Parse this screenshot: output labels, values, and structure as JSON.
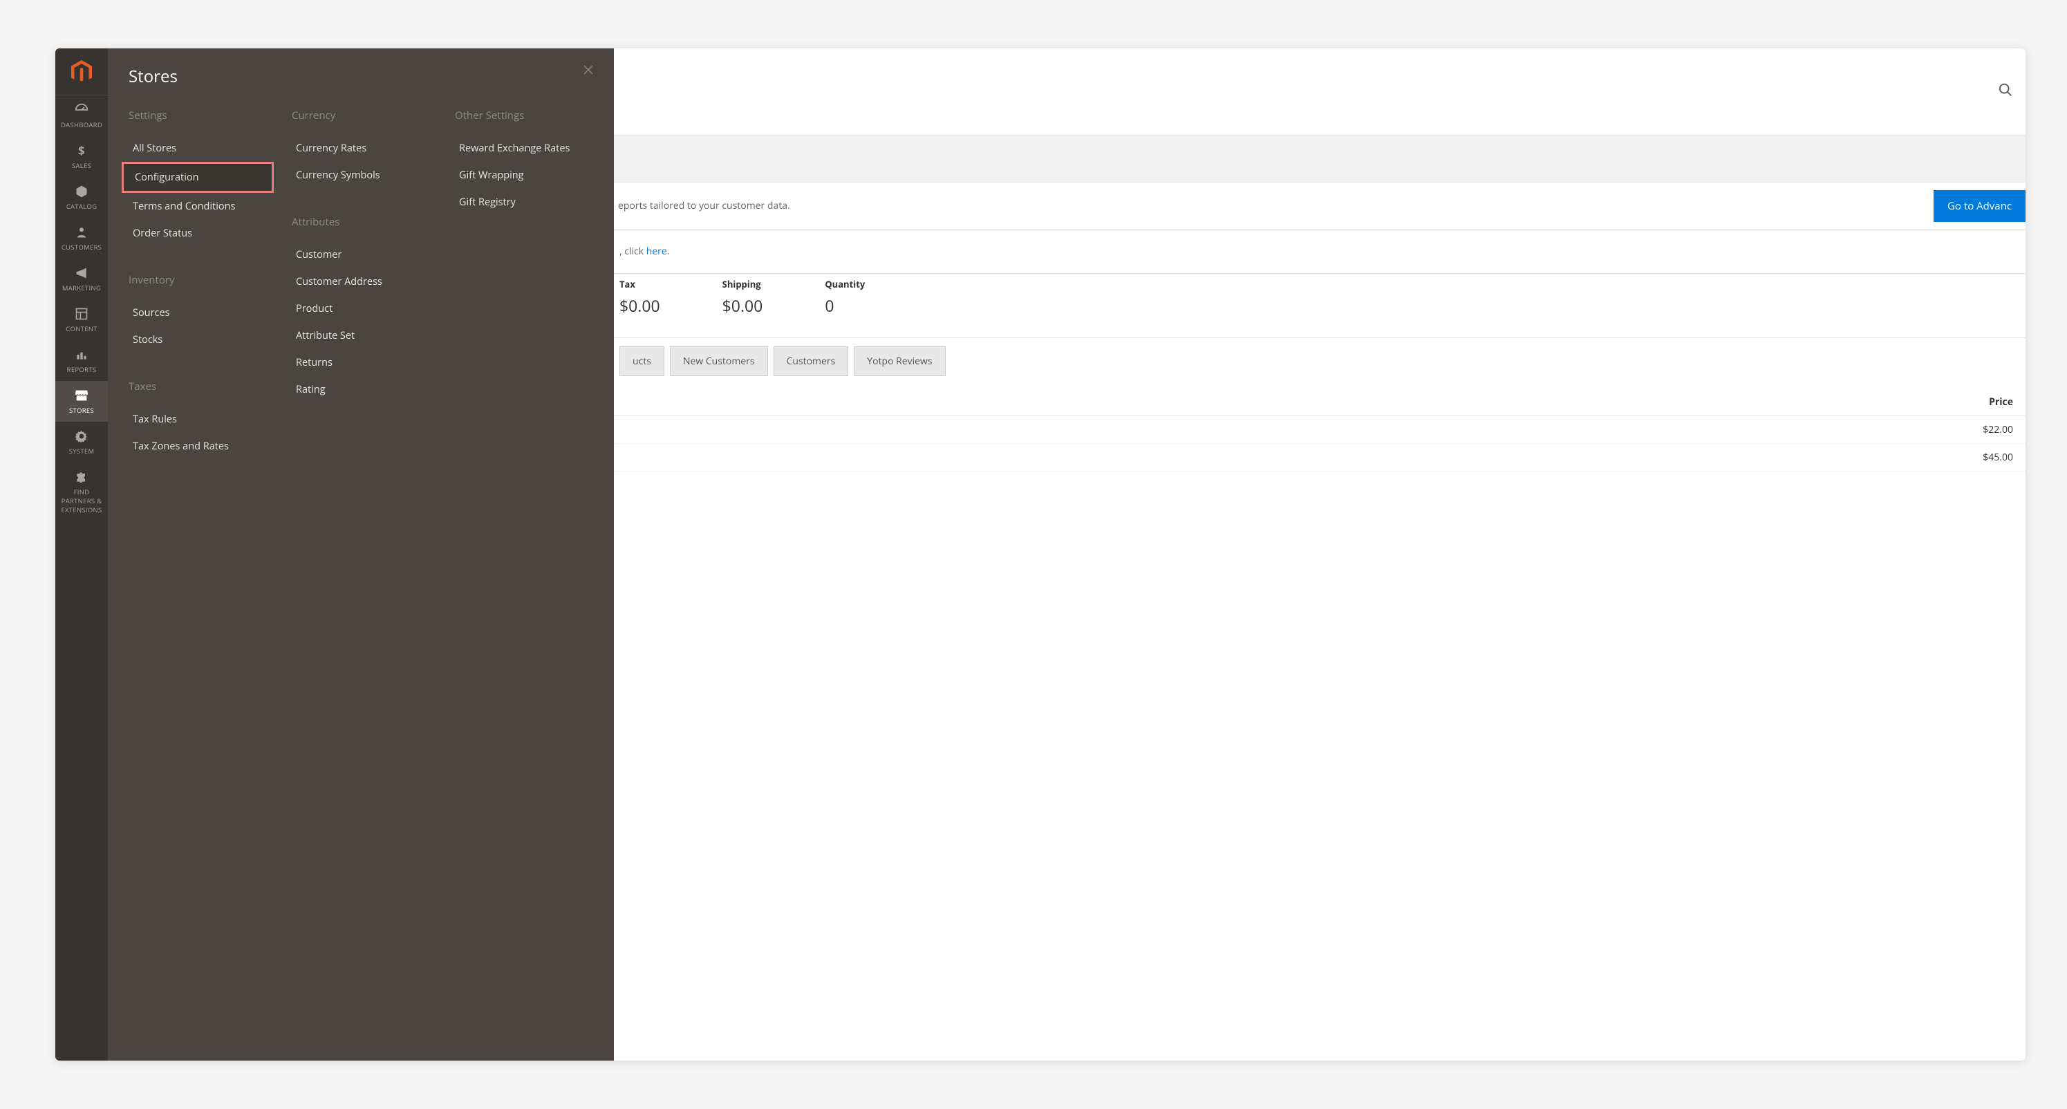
{
  "sidebar": {
    "items": [
      {
        "key": "dashboard",
        "label": "DASHBOARD"
      },
      {
        "key": "sales",
        "label": "SALES"
      },
      {
        "key": "catalog",
        "label": "CATALOG"
      },
      {
        "key": "customers",
        "label": "CUSTOMERS"
      },
      {
        "key": "marketing",
        "label": "MARKETING"
      },
      {
        "key": "content",
        "label": "CONTENT"
      },
      {
        "key": "reports",
        "label": "REPORTS"
      },
      {
        "key": "stores",
        "label": "STORES",
        "active": true
      },
      {
        "key": "system",
        "label": "SYSTEM"
      },
      {
        "key": "partners",
        "label": "FIND PARTNERS & EXTENSIONS"
      }
    ]
  },
  "flyout": {
    "title": "Stores",
    "columns": [
      {
        "groups": [
          {
            "heading": "Settings",
            "items": [
              "All Stores",
              "Configuration",
              "Terms and Conditions",
              "Order Status"
            ],
            "highlight_index": 1
          },
          {
            "heading": "Inventory",
            "items": [
              "Sources",
              "Stocks"
            ]
          },
          {
            "heading": "Taxes",
            "items": [
              "Tax Rules",
              "Tax Zones and Rates"
            ]
          }
        ]
      },
      {
        "groups": [
          {
            "heading": "Currency",
            "items": [
              "Currency Rates",
              "Currency Symbols"
            ]
          },
          {
            "heading": "Attributes",
            "items": [
              "Customer",
              "Customer Address",
              "Product",
              "Attribute Set",
              "Returns",
              "Rating"
            ]
          }
        ]
      },
      {
        "groups": [
          {
            "heading": "Other Settings",
            "items": [
              "Reward Exchange Rates",
              "Gift Wrapping",
              "Gift Registry"
            ]
          }
        ]
      }
    ]
  },
  "main": {
    "promo_text": "eports tailored to your customer data.",
    "promo_button": "Go to Advanc",
    "info_prefix": ", click ",
    "info_link": "here",
    "info_suffix": ".",
    "stats": [
      {
        "label": "Tax",
        "value": "$0.00"
      },
      {
        "label": "Shipping",
        "value": "$0.00"
      },
      {
        "label": "Quantity",
        "value": "0"
      }
    ],
    "tabs": [
      "ucts",
      "New Customers",
      "Customers",
      "Yotpo Reviews"
    ],
    "table": {
      "header": "Price",
      "rows": [
        "$22.00",
        "$45.00"
      ]
    }
  }
}
